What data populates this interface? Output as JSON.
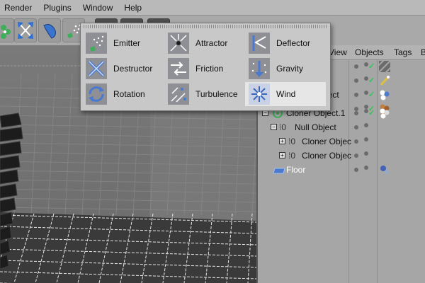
{
  "menubar": {
    "items": [
      "Render",
      "Plugins",
      "Window",
      "Help"
    ]
  },
  "popup": {
    "items": [
      {
        "label": "Emitter",
        "icon": "emitter-icon"
      },
      {
        "label": "Attractor",
        "icon": "attractor-icon"
      },
      {
        "label": "Deflector",
        "icon": "deflector-icon"
      },
      {
        "label": "Destructor",
        "icon": "destructor-icon"
      },
      {
        "label": "Friction",
        "icon": "friction-icon"
      },
      {
        "label": "Gravity",
        "icon": "gravity-icon"
      },
      {
        "label": "Rotation",
        "icon": "rotation-icon"
      },
      {
        "label": "Turbulence",
        "icon": "turbulence-icon"
      },
      {
        "label": "Wind",
        "icon": "wind-icon",
        "highlighted": true
      }
    ]
  },
  "panel": {
    "tabs": [
      "View",
      "Objects",
      "Tags",
      "B"
    ],
    "partial_labels": [
      "t",
      "Object"
    ],
    "objects": [
      {
        "label": "Cloner Object.1"
      },
      {
        "label": "Null Object"
      },
      {
        "label": "Cloner Objec"
      },
      {
        "label": "Cloner Objec"
      },
      {
        "label": "Floor"
      }
    ]
  },
  "colors": {
    "check": "#3cc05a",
    "menu_highlight": "#e6e6e6",
    "panel": "#a6a6a6"
  }
}
